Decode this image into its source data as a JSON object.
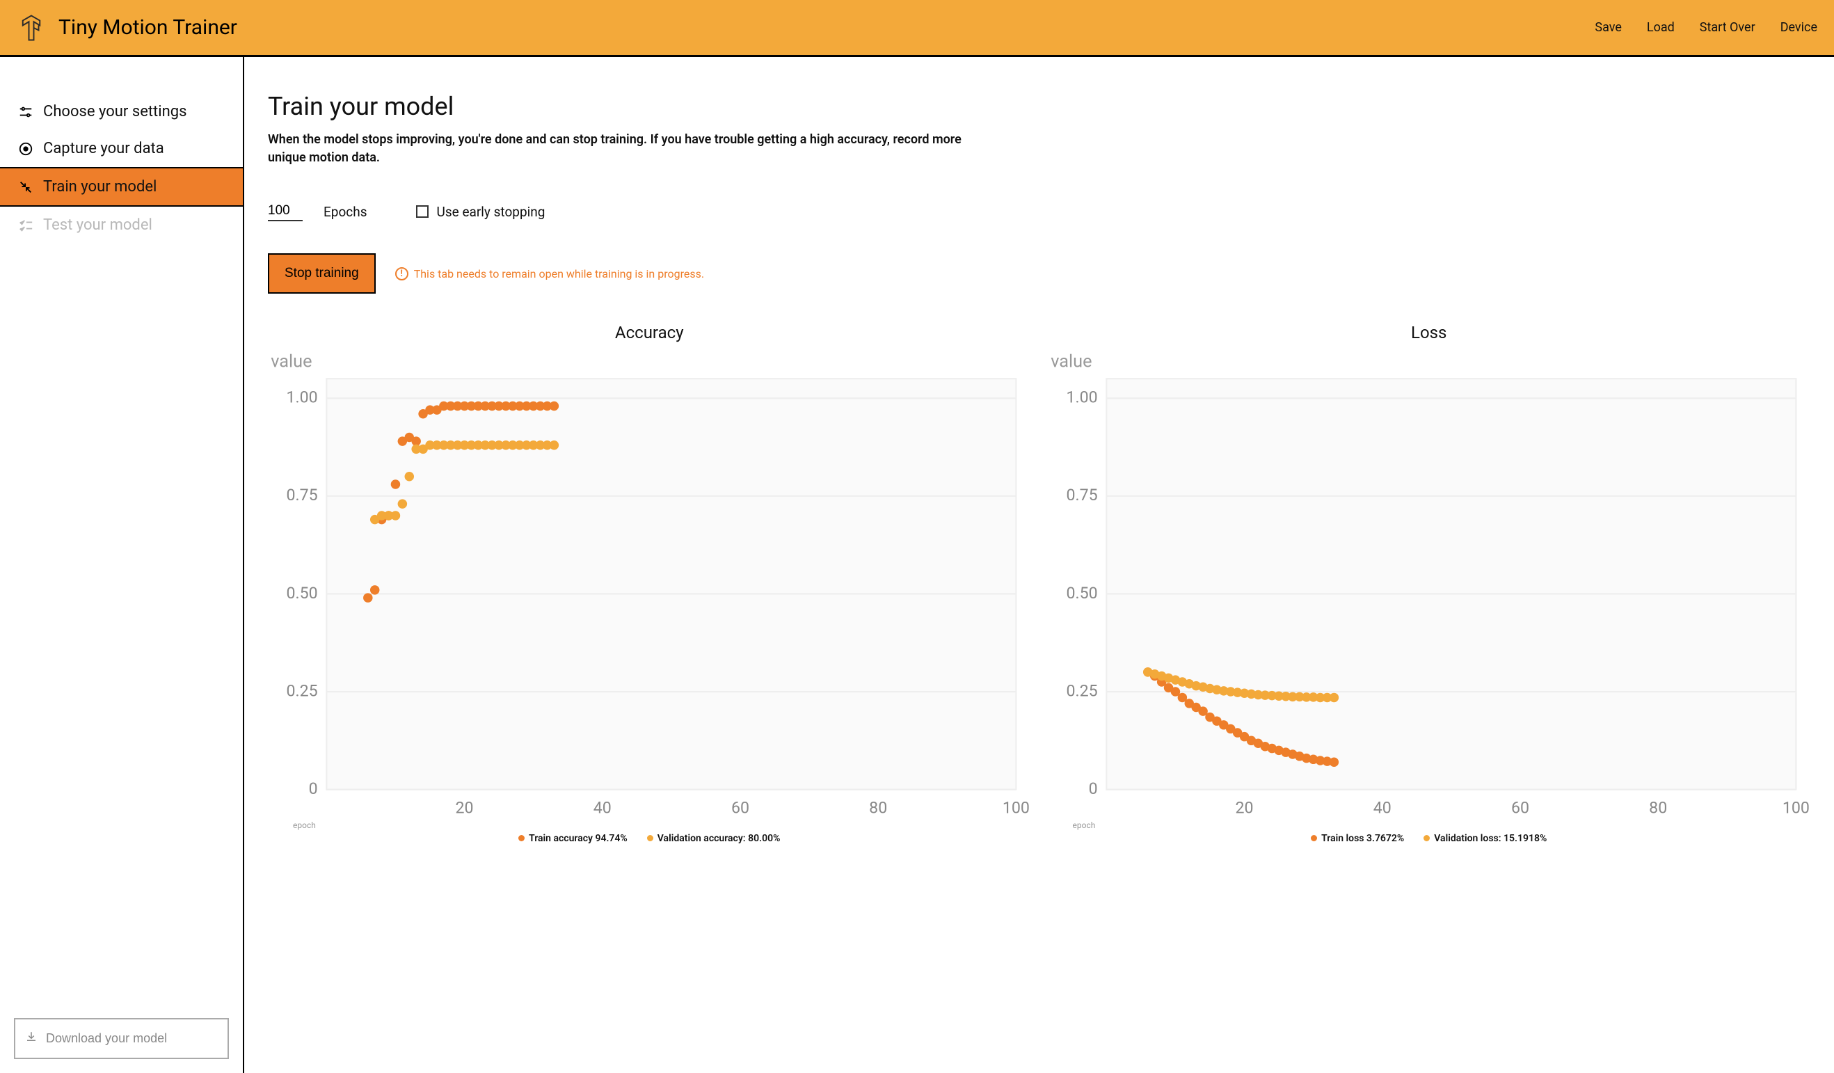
{
  "header": {
    "title": "Tiny Motion Trainer",
    "nav": [
      "Save",
      "Load",
      "Start Over",
      "Device"
    ]
  },
  "sidebar": {
    "items": [
      {
        "label": "Choose your settings"
      },
      {
        "label": "Capture your data"
      },
      {
        "label": "Train your model"
      },
      {
        "label": "Test your model"
      }
    ],
    "download_label": "Download your model"
  },
  "main": {
    "title": "Train your model",
    "description": "When the model stops improving, you're done and can stop training. If you have trouble getting a high accuracy, record more unique motion data.",
    "epochs_value": "100",
    "epochs_label": "Epochs",
    "early_stop_label": "Use early stopping",
    "stop_button": "Stop training",
    "warning_text": "This tab needs to remain open while training is in progress."
  },
  "colors": {
    "train": "#ee7e2a",
    "validation": "#f3a93a"
  },
  "chart_data": [
    {
      "type": "scatter",
      "title": "Accuracy",
      "xlabel": "epoch",
      "ylabel": "value",
      "xlim": [
        0,
        100
      ],
      "ylim": [
        0,
        1.05
      ],
      "xticks": [
        20,
        40,
        60,
        80,
        100
      ],
      "yticks": [
        0,
        0.25,
        0.5,
        0.75,
        1.0
      ],
      "series": [
        {
          "name": "Train accuracy",
          "current": "94.74%",
          "color": "#ee7e2a",
          "x": [
            6,
            7,
            8,
            9,
            10,
            11,
            12,
            13,
            14,
            15,
            16,
            17,
            18,
            19,
            20,
            21,
            22,
            23,
            24,
            25,
            26,
            27,
            28,
            29,
            30,
            31,
            32,
            33
          ],
          "y": [
            0.49,
            0.51,
            0.69,
            0.7,
            0.78,
            0.89,
            0.9,
            0.89,
            0.96,
            0.97,
            0.97,
            0.98,
            0.98,
            0.98,
            0.98,
            0.98,
            0.98,
            0.98,
            0.98,
            0.98,
            0.98,
            0.98,
            0.98,
            0.98,
            0.98,
            0.98,
            0.98,
            0.98
          ]
        },
        {
          "name": "Validation accuracy",
          "current": "80.00%",
          "color": "#f3a93a",
          "x": [
            7,
            8,
            9,
            10,
            11,
            12,
            13,
            14,
            15,
            16,
            17,
            18,
            19,
            20,
            21,
            22,
            23,
            24,
            25,
            26,
            27,
            28,
            29,
            30,
            31,
            32,
            33
          ],
          "y": [
            0.69,
            0.7,
            0.7,
            0.7,
            0.73,
            0.8,
            0.87,
            0.87,
            0.88,
            0.88,
            0.88,
            0.88,
            0.88,
            0.88,
            0.88,
            0.88,
            0.88,
            0.88,
            0.88,
            0.88,
            0.88,
            0.88,
            0.88,
            0.88,
            0.88,
            0.88,
            0.88
          ]
        }
      ],
      "legend_template": [
        "Train accuracy {v}",
        "Validation accuracy: {v}"
      ]
    },
    {
      "type": "scatter",
      "title": "Loss",
      "xlabel": "epoch",
      "ylabel": "value",
      "xlim": [
        0,
        100
      ],
      "ylim": [
        0,
        1.05
      ],
      "xticks": [
        20,
        40,
        60,
        80,
        100
      ],
      "yticks": [
        0,
        0.25,
        0.5,
        0.75,
        1.0
      ],
      "series": [
        {
          "name": "Train loss",
          "current": "3.7672%",
          "color": "#ee7e2a",
          "x": [
            6,
            7,
            8,
            9,
            10,
            11,
            12,
            13,
            14,
            15,
            16,
            17,
            18,
            19,
            20,
            21,
            22,
            23,
            24,
            25,
            26,
            27,
            28,
            29,
            30,
            31,
            32,
            33
          ],
          "y": [
            0.3,
            0.29,
            0.275,
            0.26,
            0.25,
            0.235,
            0.22,
            0.21,
            0.2,
            0.185,
            0.175,
            0.165,
            0.155,
            0.145,
            0.135,
            0.125,
            0.118,
            0.11,
            0.105,
            0.1,
            0.095,
            0.09,
            0.085,
            0.08,
            0.077,
            0.074,
            0.072,
            0.07
          ]
        },
        {
          "name": "Validation loss",
          "current": "15.1918%",
          "color": "#f3a93a",
          "x": [
            6,
            7,
            8,
            9,
            10,
            11,
            12,
            13,
            14,
            15,
            16,
            17,
            18,
            19,
            20,
            21,
            22,
            23,
            24,
            25,
            26,
            27,
            28,
            29,
            30,
            31,
            32,
            33
          ],
          "y": [
            0.3,
            0.295,
            0.29,
            0.285,
            0.28,
            0.275,
            0.27,
            0.265,
            0.262,
            0.258,
            0.255,
            0.252,
            0.25,
            0.248,
            0.246,
            0.244,
            0.242,
            0.241,
            0.24,
            0.239,
            0.238,
            0.237,
            0.237,
            0.236,
            0.236,
            0.235,
            0.235,
            0.235
          ]
        }
      ],
      "legend_template": [
        "Train loss {v}",
        "Validation loss: {v}"
      ]
    }
  ]
}
